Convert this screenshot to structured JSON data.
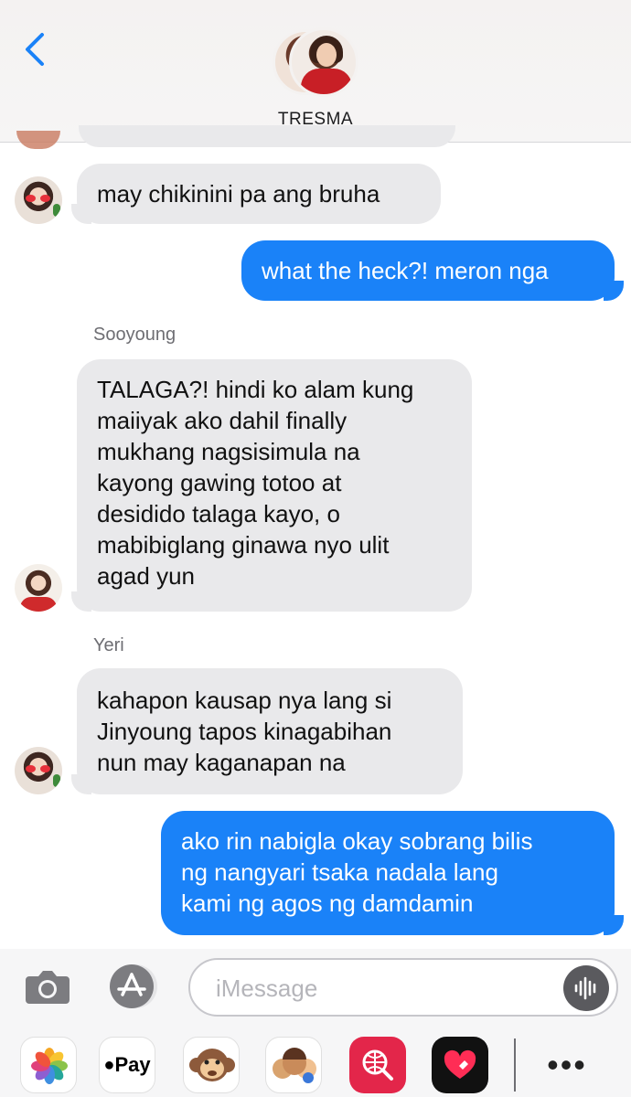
{
  "header": {
    "contact_name": "TRESMA"
  },
  "messages": [
    {
      "direction": "incoming",
      "sender": "",
      "text": "may chikinini pa ang bruha"
    },
    {
      "direction": "outgoing",
      "text": "what the heck?! meron nga"
    },
    {
      "direction": "incoming",
      "sender": "Sooyoung",
      "lines": [
        "TALAGA?! hindi ko alam kung",
        "maiiyak ako dahil finally",
        "mukhang nagsisimula na",
        "kayong gawing totoo at",
        "desidido talaga kayo, o",
        "mabibiglang ginawa nyo ulit",
        "agad yun"
      ]
    },
    {
      "direction": "incoming",
      "sender": "Yeri",
      "lines": [
        "kahapon kausap nya lang si",
        "Jinyoung tapos kinagabihan",
        "nun may kaganapan na"
      ]
    },
    {
      "direction": "outgoing",
      "lines": [
        "ako rin nabigla okay sobrang bilis",
        "ng nangyari tsaka nadala lang",
        "kami ng agos ng damdamin"
      ]
    }
  ],
  "input": {
    "placeholder": "iMessage",
    "value": ""
  },
  "drawer": {
    "applepay_label": "Pay",
    "more_label": "•••"
  },
  "colors": {
    "outgoing_bubble": "#1a82f8",
    "incoming_bubble": "#e9e9eb",
    "back_chevron": "#1a82f8"
  }
}
